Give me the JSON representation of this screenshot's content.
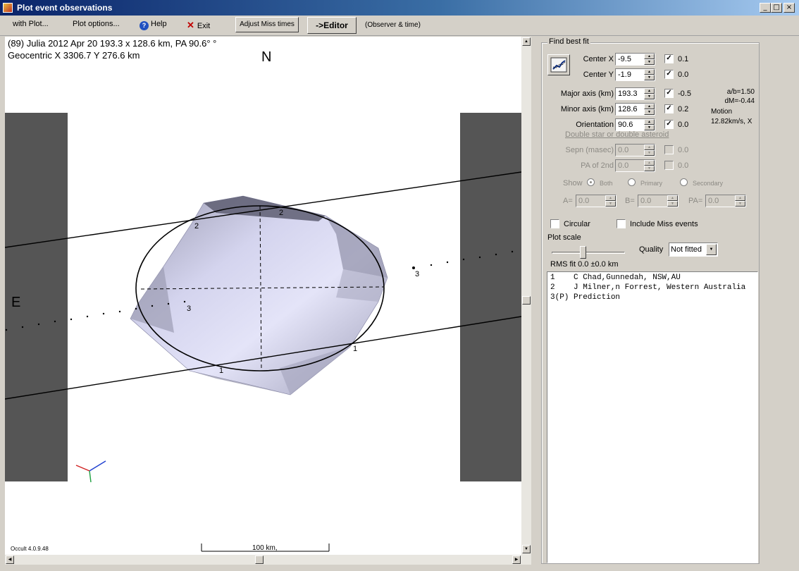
{
  "window": {
    "title": "Plot event observations"
  },
  "menu": {
    "with_plot": "with Plot...",
    "plot_options": "Plot options...",
    "help": "Help",
    "exit": "Exit",
    "adjust_miss": "Adjust Miss times",
    "editor": "->Editor",
    "observer_time": "(Observer & time)"
  },
  "plot": {
    "info_line1": "(89) Julia  2012 Apr 20   193.3 x 128.6 km, PA 90.6° °",
    "info_line2": "Geocentric X  3306.7  Y 276.6 km",
    "north": "N",
    "east": "E",
    "version": "Occult 4.0.9.48",
    "scale_label": "100 km,",
    "chord_labels": [
      "1",
      "1",
      "2",
      "2",
      "3",
      "3"
    ]
  },
  "fit": {
    "group_title": "Find best fit",
    "center_x": {
      "label": "Center X",
      "value": "-9.5",
      "checked": true,
      "result": "0.1"
    },
    "center_y": {
      "label": "Center Y",
      "value": "-1.9",
      "checked": true,
      "result": "0.0"
    },
    "major_axis": {
      "label": "Major axis (km)",
      "value": "193.3",
      "checked": true,
      "result": "-0.5"
    },
    "minor_axis": {
      "label": "Minor axis (km)",
      "value": "128.6",
      "checked": true,
      "result": "0.2"
    },
    "orientation": {
      "label": "Orientation",
      "value": "90.6",
      "checked": true,
      "result": "0.0"
    },
    "ab_ratio": "a/b=1.50",
    "dm": "dM=-0.44",
    "motion_label": "Motion",
    "motion_value": "12.82km/s, X",
    "double_header": "Double star  or  double asteroid",
    "sepn": {
      "label": "Sepn (masec)",
      "value": "0.0",
      "result": "0.0"
    },
    "pa2": {
      "label": "PA of 2nd",
      "value": "0.0",
      "result": "0.0"
    },
    "show_label": "Show",
    "show_both": "Both",
    "show_primary": "Primary",
    "show_secondary": "Secondary",
    "a_label": "A=",
    "a_value": "0.0",
    "b_label": "B=",
    "b_value": "0.0",
    "pa_label": "PA=",
    "pa_value": "0.0",
    "circular": "Circular",
    "include_miss": "Include Miss events",
    "plot_scale": "Plot scale",
    "quality_label": "Quality",
    "quality_value": "Not fitted",
    "rms": "RMS fit 0.0 ±0.0 km"
  },
  "observers": [
    {
      "text": "1    C Chad,Gunnedah, NSW,AU"
    },
    {
      "text": "2    J Milner,n Forrest, Western Australia"
    },
    {
      "text": "3(P) Prediction"
    }
  ]
}
